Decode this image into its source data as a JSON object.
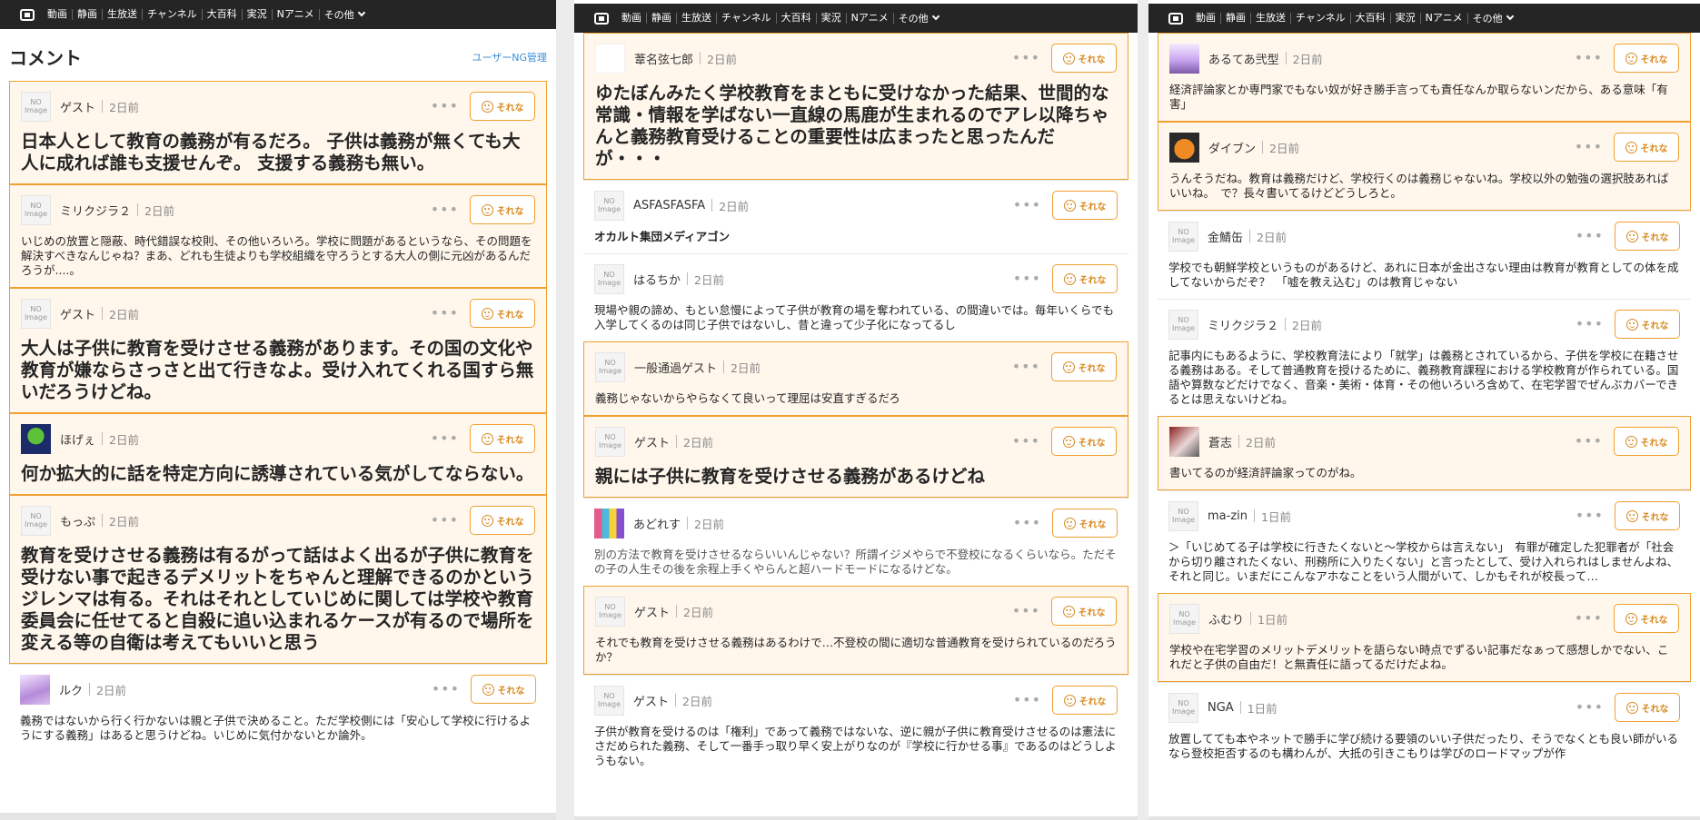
{
  "nav": {
    "items": [
      "動画",
      "静画",
      "生放送",
      "チャンネル",
      "大百科",
      "実況",
      "Nアニメ"
    ],
    "more": "その他"
  },
  "header": {
    "title": "コメント",
    "ng_link": "ユーザーNG管理"
  },
  "reaction_label": "それな",
  "avatar_placeholder": {
    "line1": "NO",
    "line2": "Image"
  },
  "colors": {
    "accent": "#f0a030",
    "highlight_bg": "#fff7ec",
    "navbar": "#252525",
    "link": "#3b8fd6"
  },
  "panel1": [
    {
      "user": "ゲスト",
      "time": "2日前",
      "text": "日本人として教育の義務が有るだろ。 子供は義務が無くても大人に成れば誰も支援せんぞ。 支援する義務も無い。",
      "size": "lg",
      "hl": true,
      "avatar": "none"
    },
    {
      "user": "ミリクジラ２",
      "time": "2日前",
      "text": "いじめの放置と隠蔽、時代錯誤な校則、その他いろいろ。学校に問題があるというなら、その問題を解決すべきなんじゃね？まあ、どれも生徒よりも学校組織を守ろうとする大人の側に元凶があるんだろうが....。",
      "size": "sm",
      "hl": true,
      "avatar": "none"
    },
    {
      "user": "ゲスト",
      "time": "2日前",
      "text": "大人は子供に教育を受けさせる義務があります。その国の文化や教育が嫌ならさっさと出て行きなよ。受け入れてくれる国すら無いだろうけどね。",
      "size": "lg",
      "hl": true,
      "avatar": "none"
    },
    {
      "user": "ほげぇ",
      "time": "2日前",
      "text": "何か拡大的に話を特定方向に誘導されている気がしてならない。",
      "size": "lg",
      "hl": true,
      "avatar": "green"
    },
    {
      "user": "もっぷ",
      "time": "2日前",
      "text": "教育を受けさせる義務は有るがって話はよく出るが子供に教育を受けない事で起きるデメリットをちゃんと理解できるのかというジレンマは有る。それはそれとしていじめに関しては学校や教育委員会に任せてると自殺に追い込まれるケースが有るので場所を変える等の自衛は考えてもいいと思う",
      "size": "lg",
      "hl": true,
      "avatar": "none"
    },
    {
      "user": "ルク",
      "time": "2日前",
      "text": "義務ではないから行く行かないは親と子供で決めること。ただ学校側には「安心して学校に行けるようにする義務」はあると思うけどね。いじめに気付かないとか論外。",
      "size": "sm",
      "hl": false,
      "avatar": "purple"
    }
  ],
  "panel2": [
    {
      "user": "葦名弦七郎",
      "time": "2日前",
      "text": "ゆたぼんみたく学校教育をまともに受けなかった結果、世間的な常識・情報を学ばない一直線の馬鹿が生まれるのでアレ以降ちゃんと義務教育受けることの重要性は広まったと思ったんだが・・・",
      "size": "lg",
      "hl": true,
      "avatar": "white"
    },
    {
      "user": "ASFASFASFA",
      "time": "2日前",
      "text": "オカルト集団メディアゴン",
      "size": "sm",
      "hl": false,
      "avatar": "none",
      "bold": true
    },
    {
      "user": "はるちか",
      "time": "2日前",
      "text": "現場や親の諦め、もとい怠慢によって子供が教育の場を奪われている、の間違いでは。毎年いくらでも入学してくるのは同じ子供ではないし、昔と違って少子化になってるし",
      "size": "sm",
      "hl": false,
      "avatar": "none"
    },
    {
      "user": "一般通過ゲスト",
      "time": "2日前",
      "text": "義務じゃないからやらなくて良いって理屈は安直すぎるだろ",
      "size": "sm",
      "hl": true,
      "avatar": "none"
    },
    {
      "user": "ゲスト",
      "time": "2日前",
      "text": "親には子供に教育を受けさせる義務があるけどね",
      "size": "lg",
      "hl": true,
      "avatar": "none"
    },
    {
      "user": "あどれす",
      "time": "2日前",
      "text": "別の方法で教育を受けさせるならいいんじゃない？所謂イジメやらで不登校になるくらいなら。ただその子の人生その後を余程上手くやらんと超ハードモードになるけどな。",
      "size": "sm",
      "hl": false,
      "avatar": "pixel",
      "gray": true
    },
    {
      "user": "ゲスト",
      "time": "2日前",
      "text": "それでも教育を受けさせる義務はあるわけで…不登校の間に適切な普通教育を受けられているのだろうか？",
      "size": "sm",
      "hl": true,
      "avatar": "none"
    },
    {
      "user": "ゲスト",
      "time": "2日前",
      "text": "子供が教育を受けるのは「権利」であって義務ではないな、逆に親が子供に教育受けさせるのは憲法にさだめられた義務、そして一番手っ取り早く安上がりなのが『学校に行かせる事』であるのはどうしようもない。",
      "size": "sm",
      "hl": false,
      "avatar": "none"
    }
  ],
  "panel3": [
    {
      "user": "あるてあ弐型",
      "time": "2日前",
      "text": "経済評論家とか専門家でもない奴が好き勝手言っても責任なんか取らないンだから、ある意味「有害」",
      "size": "sm",
      "hl": true,
      "avatar": "anime"
    },
    {
      "user": "ダイブン",
      "time": "2日前",
      "text": "うんそうだね。教育は義務だけど、学校行くのは義務じゃないね。学校以外の勉強の選択肢あればいいね。　で？長々書いてるけどどうしろと。",
      "size": "sm",
      "hl": true,
      "avatar": "orange"
    },
    {
      "user": "金鯖缶",
      "time": "2日前",
      "text": "学校でも朝鮮学校というものがあるけど、あれに日本が金出さない理由は教育が教育としての体を成してないからだぞ？　「嘘を教え込む」のは教育じゃない",
      "size": "sm",
      "hl": false,
      "avatar": "none"
    },
    {
      "user": "ミリクジラ２",
      "time": "2日前",
      "text": "記事内にもあるように、学校教育法により「就学」は義務とされているから、子供を学校に在籍させる義務はある。そして普通教育を授けるために、義務教育課程における学校教育が作られている。国語や算数などだけでなく、音楽・美術・体育・その他いろいろ含めて、在宅学習でぜんぶカバーできるとは思えないけどね。",
      "size": "sm",
      "hl": false,
      "avatar": "none"
    },
    {
      "user": "蒼志",
      "time": "2日前",
      "text": "書いてるのが経済評論家ってのがね。",
      "size": "sm",
      "hl": true,
      "avatar": "photo"
    },
    {
      "user": "ma-zin",
      "time": "1日前",
      "text": "＞「いじめてる子は学校に行きたくないと〜学校からは言えない」　有罪が確定した犯罪者が「社会から切り離されたくない、刑務所に入りたくない」と言ったとして、受け入れられはしませんよね、それと同じ。いまだにこんなアホなことをいう人間がいて、しかもそれが校長って…",
      "size": "sm",
      "hl": false,
      "avatar": "none"
    },
    {
      "user": "ふむり",
      "time": "1日前",
      "text": "学校や在宅学習のメリットデメリットを語らない時点でずるい記事だなぁって感想しかでない、これだと子供の自由だ！と無責任に語ってるだけだよね。",
      "size": "sm",
      "hl": true,
      "avatar": "none"
    },
    {
      "user": "NGA",
      "time": "1日前",
      "text": "放置してても本やネットで勝手に学び続ける要領のいい子供だったり、そうでなくとも良い師がいるなら登校拒否するのも構わんが、大抵の引きこもりは学びのロードマップが作",
      "size": "sm",
      "hl": false,
      "avatar": "none"
    }
  ]
}
